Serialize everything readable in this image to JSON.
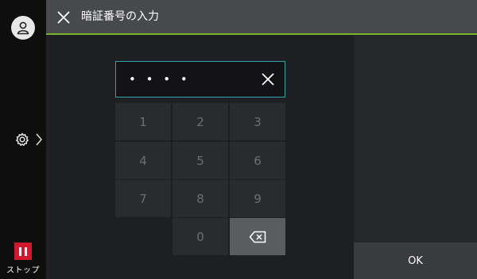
{
  "header": {
    "title": "暗証番号の入力"
  },
  "pin": {
    "value": "• • • •"
  },
  "keypad": {
    "keys": [
      "1",
      "2",
      "3",
      "4",
      "5",
      "6",
      "7",
      "8",
      "9",
      "0"
    ]
  },
  "sidebar": {
    "stop_label": "ストップ"
  },
  "actions": {
    "ok_label": "OK"
  },
  "colors": {
    "accent_green": "#79b52c",
    "field_border": "#2fa3a6",
    "stop_red": "#d0182e"
  },
  "icons": {
    "close": "close-icon",
    "user": "user-icon",
    "settings": "gear-icon",
    "expand": "chevron-right-icon",
    "stop": "pause-icon",
    "clear": "clear-icon",
    "backspace": "backspace-icon"
  }
}
